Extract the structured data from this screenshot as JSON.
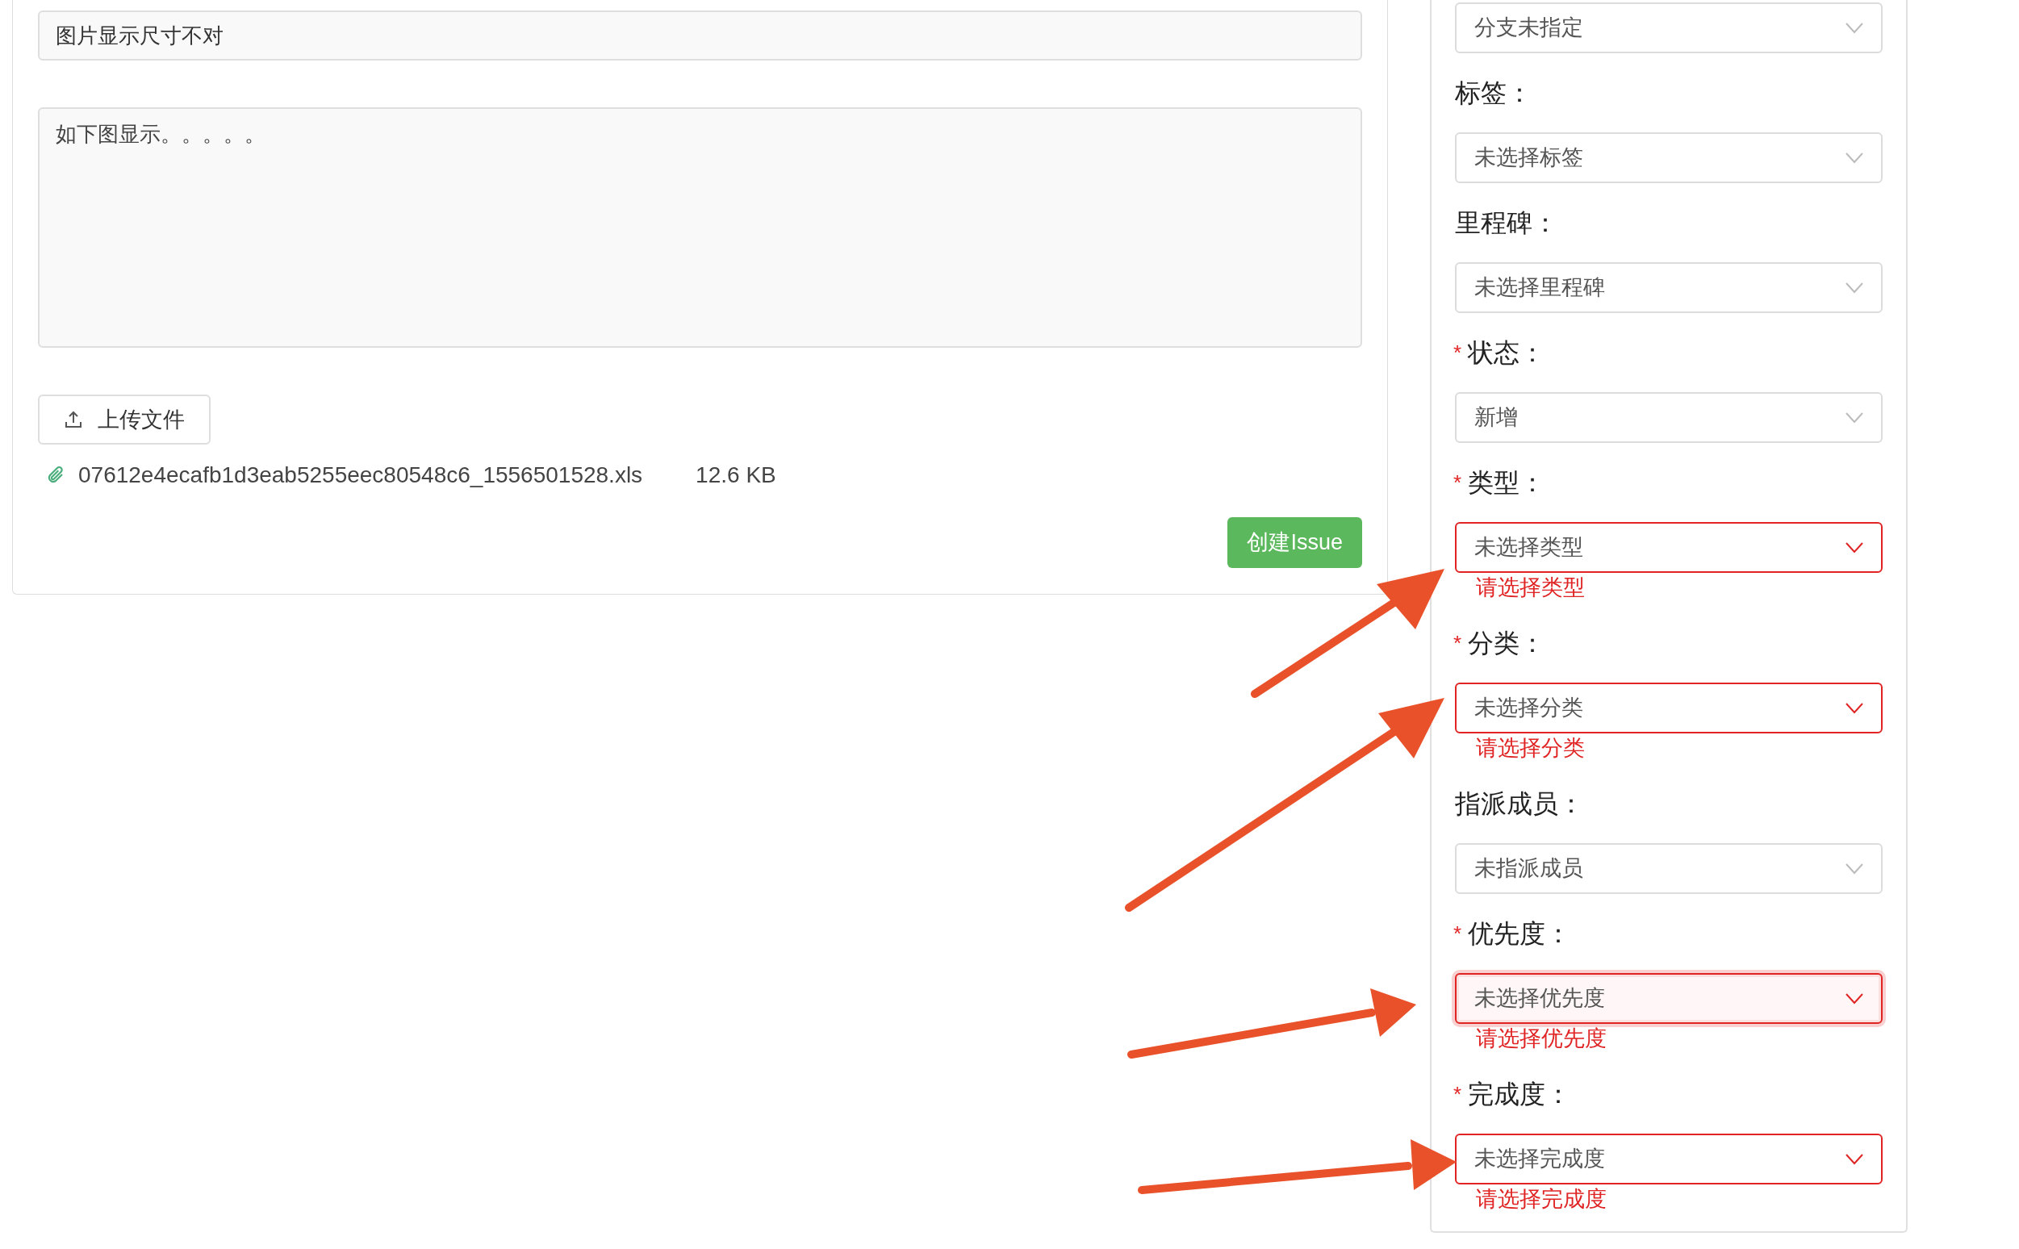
{
  "issue_form": {
    "title_value": "图片显示尺寸不对",
    "description_value": "如下图显示。。。。。",
    "upload_button": "上传文件",
    "attachments": [
      {
        "file_name": "07612e4ecafb1d3eab5255eec80548c6_1556501528.xls",
        "size": "12.6 KB"
      }
    ],
    "submit_button": "创建Issue"
  },
  "sidebar": {
    "fields": [
      {
        "value": "分支未指定",
        "focused": false
      },
      {
        "label": "标签：",
        "value": "未选择标签",
        "required": false,
        "focused": false
      },
      {
        "label": "里程碑：",
        "value": "未选择里程碑",
        "required": false,
        "focused": false
      },
      {
        "label": "状态：",
        "value": "新增",
        "required": true,
        "focused": false
      },
      {
        "label": "类型：",
        "value": "未选择类型",
        "required": true,
        "focused": false,
        "error": "请选择类型"
      },
      {
        "label": "分类：",
        "value": "未选择分类",
        "required": true,
        "focused": false,
        "error": "请选择分类"
      },
      {
        "label": "指派成员：",
        "value": "未指派成员",
        "required": false,
        "focused": false
      },
      {
        "label": "优先度：",
        "value": "未选择优先度",
        "required": true,
        "focused": true,
        "error": "请选择优先度"
      },
      {
        "label": "完成度：",
        "value": "未选择完成度",
        "required": true,
        "focused": false,
        "error": "请选择完成度"
      }
    ]
  },
  "required_mark": "*"
}
